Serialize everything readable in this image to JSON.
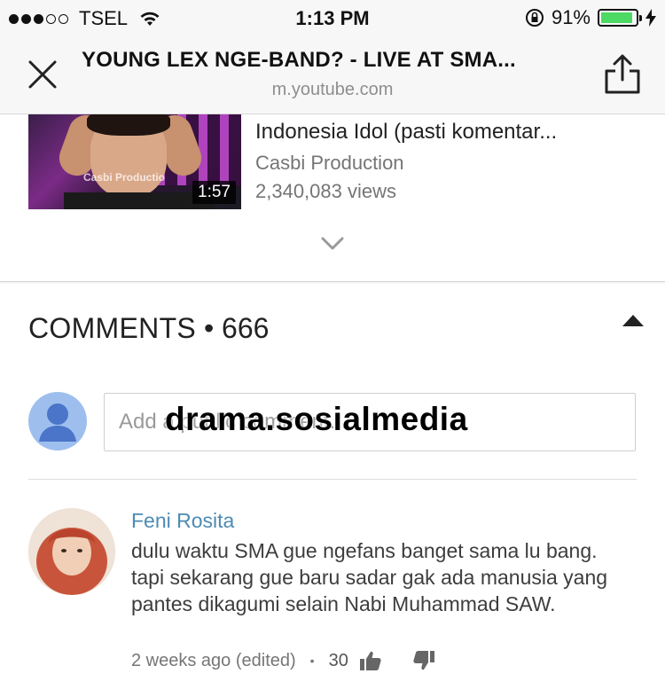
{
  "status_bar": {
    "carrier": "TSEL",
    "time": "1:13 PM",
    "battery_percent": "91%",
    "battery_level": 0.91,
    "signal_filled": 3,
    "signal_total": 5
  },
  "browser": {
    "title": "YOUNG LEX NGE-BAND? - LIVE AT SMA...",
    "url": "m.youtube.com"
  },
  "related_video": {
    "title_partial": "",
    "title": "Indonesia Idol (pasti komentar...",
    "channel": "Casbi Production",
    "views": "2,340,083 views",
    "duration": "1:57",
    "thumbnail_watermark": "Casbi Productio"
  },
  "comments": {
    "label": "COMMENTS",
    "separator": "•",
    "count": "666",
    "input_placeholder": "Add a public comment...",
    "items": [
      {
        "author": "Feni Rosita",
        "text": "dulu waktu SMA gue ngefans banget sama lu bang. tapi sekarang gue baru sadar gak ada manusia yang pantes dikagumi selain Nabi Muhammad SAW.",
        "time": "2 weeks ago (edited)",
        "likes": "30"
      }
    ]
  },
  "overlay_watermark": "drama.sosialmedia",
  "colors": {
    "author_link": "#4d8bb3",
    "battery": "#4cd964",
    "avatar_placeholder": "#9ebfee"
  }
}
